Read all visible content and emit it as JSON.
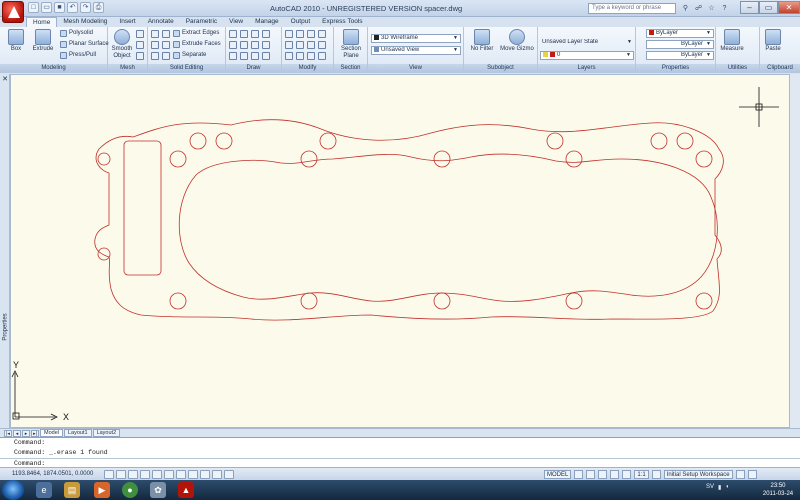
{
  "titlebar": {
    "title": "AutoCAD 2010 - UNREGISTERED VERSION    spacer.dwg",
    "search_placeholder": "Type a keyword or phrase",
    "controls": [
      "–",
      "▭",
      "✕"
    ]
  },
  "menu_tabs": [
    "Home",
    "Mesh Modeling",
    "Insert",
    "Annotate",
    "Parametric",
    "View",
    "Manage",
    "Output",
    "Express Tools"
  ],
  "ribbon": {
    "modeling": {
      "title": "Modeling",
      "box": "Box",
      "extrude": "Extrude",
      "polysolid": "Polysolid",
      "planar_surface": "Planar Surface",
      "press_pull": "Press/Pull"
    },
    "mesh": {
      "title": "Mesh",
      "smooth_object": "Smooth Object"
    },
    "solid_editing": {
      "title": "Solid Editing",
      "extract_edges": "Extract Edges",
      "extrude_faces": "Extrude Faces",
      "separate": "Separate"
    },
    "draw": {
      "title": "Draw"
    },
    "modify": {
      "title": "Modify"
    },
    "section": {
      "title": "Section",
      "section_plane": "Section Plane"
    },
    "view": {
      "title": "View",
      "visual_style": "3D Wireframe",
      "named_view": "Unsaved View"
    },
    "subobject": {
      "title": "Subobject",
      "no_filter": "No Filter",
      "move_gizmo": "Move Gizmo"
    },
    "layers": {
      "title": "Layers",
      "layer_state": "Unsaved Layer State",
      "current_layer": "0"
    },
    "properties": {
      "title": "Properties",
      "color": "ByLayer",
      "linetype": "ByLayer",
      "lineweight": "ByLayer"
    },
    "utilities": {
      "title": "Utilities",
      "measure": "Measure"
    },
    "clipboard": {
      "title": "Clipboard",
      "paste": "Paste"
    }
  },
  "side_palette": {
    "label": "Properties",
    "close": "✕"
  },
  "ucs": {
    "x": "X",
    "y": "Y"
  },
  "layout_tabs": [
    "Model",
    "Layout1",
    "Layout2"
  ],
  "command_lines": [
    "Command:",
    "Command: _.erase 1 found",
    "Command:"
  ],
  "status": {
    "coordinates": "1193.8464, 1874.0501, 0.0000",
    "model": "MODEL",
    "scale": "1:1",
    "workspace": "Initial Setup Workspace"
  },
  "taskbar": {
    "language": "SV",
    "time": "23:50",
    "date": "2011-03-24"
  },
  "colors": {
    "drawing_bg": "#fcfaeb",
    "gasket_stroke": "#c0302a",
    "accent": "#b3140a"
  }
}
